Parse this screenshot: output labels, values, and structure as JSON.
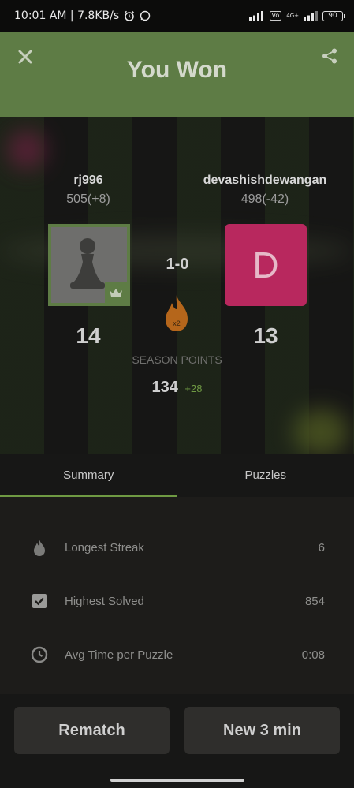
{
  "status_bar": {
    "time_speed": "10:01 AM | 7.8KB/s",
    "network_tag": "Vo",
    "lte": "4G+",
    "battery": "90"
  },
  "header": {
    "title": "You Won"
  },
  "players": {
    "left": {
      "name": "rj996",
      "rating": "505(+8)",
      "points": "14"
    },
    "right": {
      "name": "devashishdewangan",
      "rating": "498(-42)",
      "initial": "D",
      "points": "13"
    }
  },
  "match": {
    "score": "1-0",
    "streak_multiplier": "x2"
  },
  "season": {
    "label": "SEASON POINTS",
    "total": "134",
    "delta": "+28"
  },
  "tabs": [
    {
      "label": "Summary",
      "active": true
    },
    {
      "label": "Puzzles",
      "active": false
    }
  ],
  "summary": [
    {
      "icon": "flame-icon",
      "label": "Longest Streak",
      "value": "6"
    },
    {
      "icon": "checkbox-icon",
      "label": "Highest Solved",
      "value": "854"
    },
    {
      "icon": "clock-icon",
      "label": "Avg Time per Puzzle",
      "value": "0:08"
    }
  ],
  "buttons": {
    "rematch": "Rematch",
    "new_game": "New 3 min"
  },
  "colors": {
    "header_green": "#5e7c45",
    "accent_green": "#6f9a43",
    "avatar_pink": "#b8285e",
    "flame_orange": "#d27a1e"
  }
}
